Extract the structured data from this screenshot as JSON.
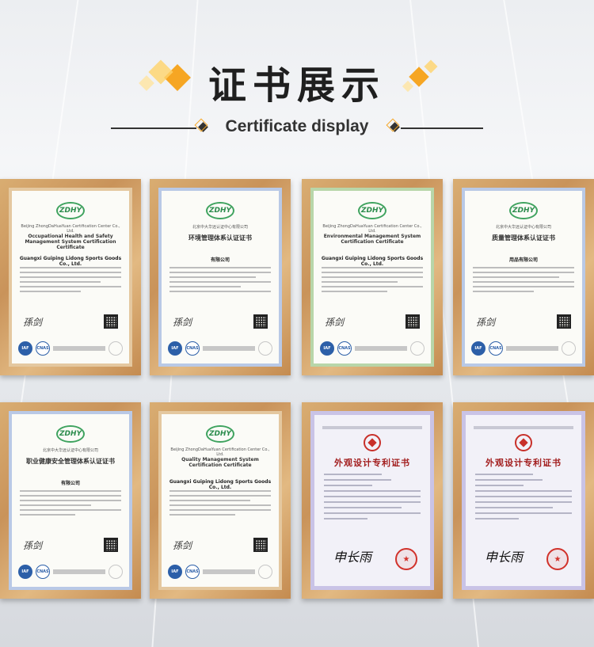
{
  "header": {
    "title": "证书展示",
    "subtitle": "Certificate display"
  },
  "colors": {
    "accent_orange": "#f6a623",
    "accent_yellow": "#ffd36a",
    "frame_wood": "#cf9a5f",
    "cert_green": "#2c8c4d",
    "patent_red": "#a21e1e"
  },
  "certificates": [
    {
      "org": "Beijing ZhongDaHuaYuan Certification Center Co., Ltd.",
      "title": "Occupational Health and Safety Management System Certification Certificate",
      "company": "Guangxi Guiping Lidong Sports Goods Co., Ltd."
    },
    {
      "org": "北京中大华远认证中心有限公司",
      "title": "环境管理体系认证证书",
      "company": "有限公司"
    },
    {
      "org": "Beijing ZhongDaHuaYuan Certification Center Co., Ltd.",
      "title": "Environmental Management System Certification Certificate",
      "company": "Guangxi Guiping Lidong Sports Goods Co., Ltd."
    },
    {
      "org": "北京中大华远认证中心有限公司",
      "title": "质量管理体系认证证书",
      "company": "用品有限公司"
    },
    {
      "org": "北京中大华远认证中心有限公司",
      "title": "职业健康安全管理体系认证证书",
      "company": "有限公司"
    },
    {
      "org": "Beijing ZhongDaHuaYuan Certification Center Co., Ltd.",
      "title": "Quality Management System Certification Certificate",
      "company": "Guangxi Guiping Lidong Sports Goods Co., Ltd."
    },
    {
      "title": "外观设计专利证书"
    },
    {
      "title": "外观设计专利证书"
    }
  ],
  "logo_text": "ZDHY"
}
